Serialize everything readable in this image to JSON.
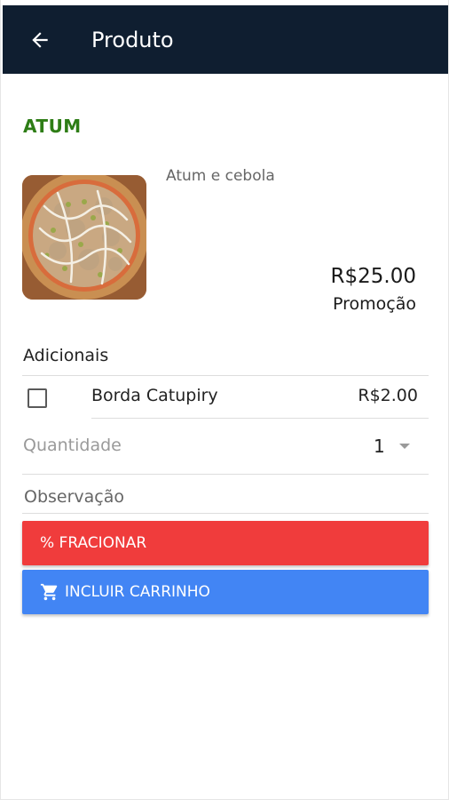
{
  "header": {
    "title": "Produto",
    "back_icon": "arrow-left-icon",
    "background": "#0f1e30"
  },
  "product": {
    "name": "ATUM",
    "name_color": "#2e7d16",
    "description": "Atum e cebola",
    "price": "R$25.00",
    "promo_label": "Promoção",
    "image": "pizza-photo"
  },
  "addons": {
    "section_label": "Adicionais",
    "items": [
      {
        "name": "Borda Catupiry",
        "price": "R$2.00",
        "checked": false
      }
    ]
  },
  "quantity": {
    "label": "Quantidade",
    "value": "1"
  },
  "observation": {
    "placeholder": "Observação",
    "value": ""
  },
  "actions": {
    "fracionar": {
      "label": "% FRACIONAR",
      "color": "#f03c3c"
    },
    "carrinho": {
      "label": "INCLUIR CARRINHO",
      "icon": "cart-icon",
      "color": "#4285f4"
    }
  }
}
